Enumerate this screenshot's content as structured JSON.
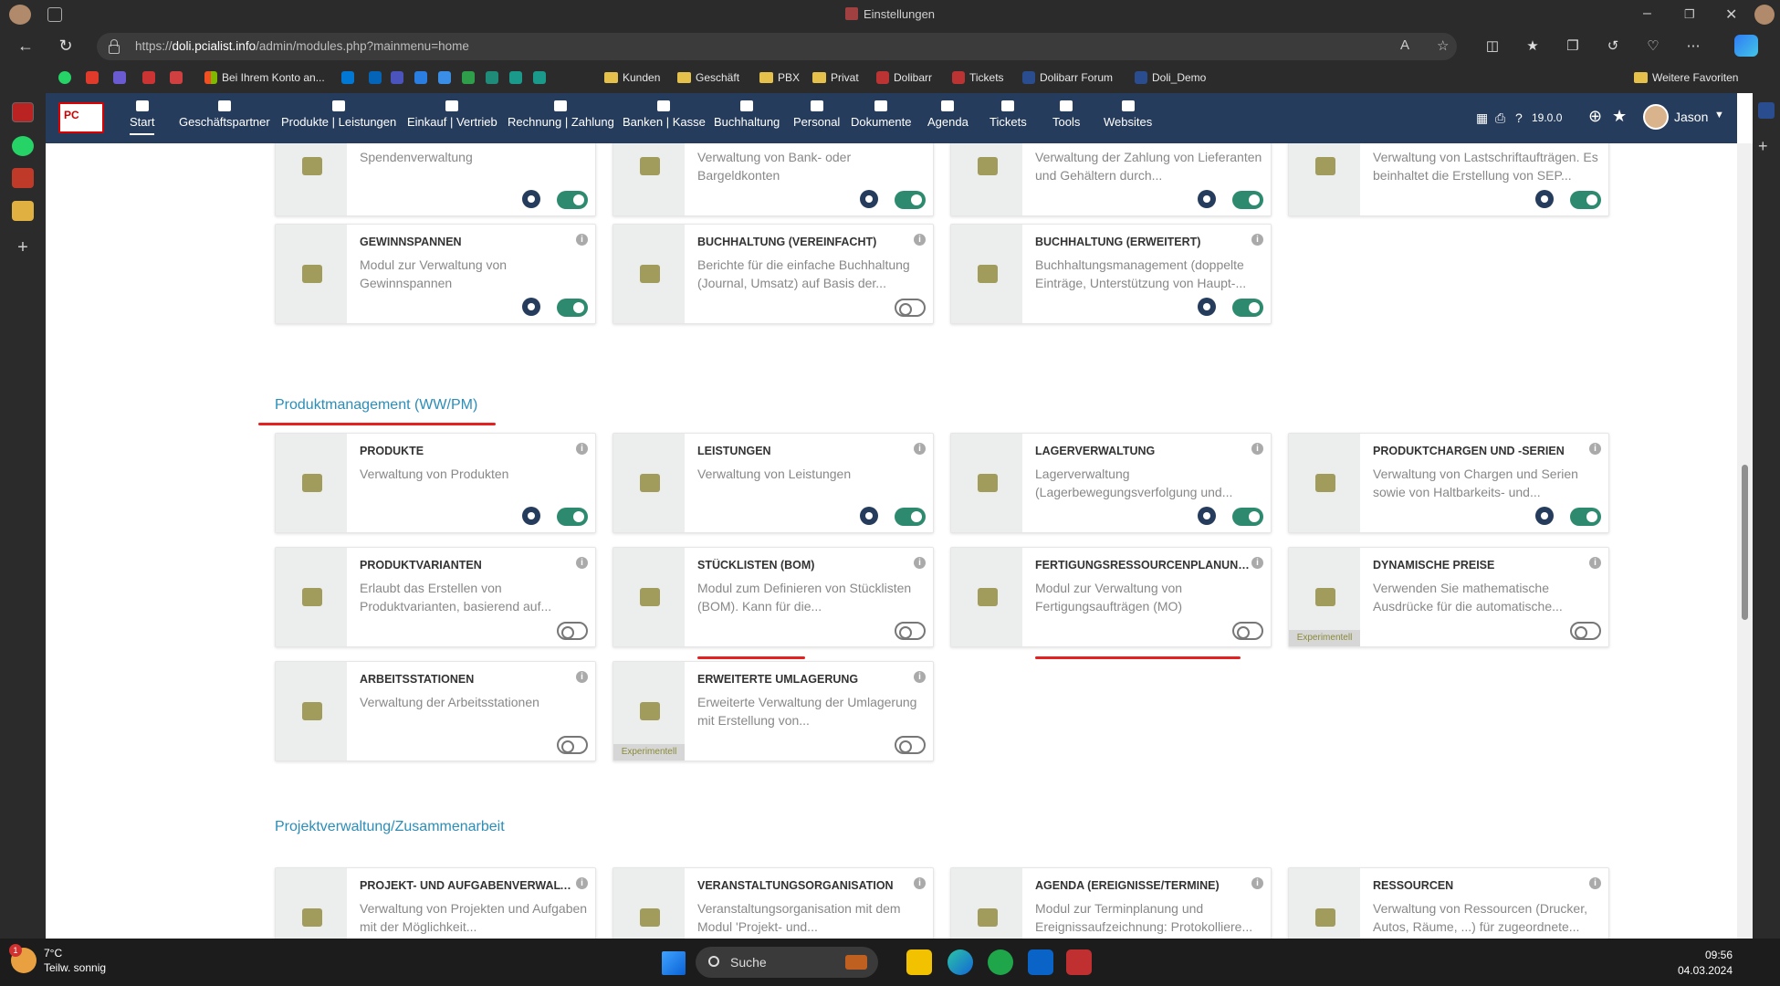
{
  "window": {
    "title": "Einstellungen"
  },
  "address": {
    "url_prefix": "https://",
    "url_host": "doli.pcialist.info",
    "url_path": "/admin/modules.php?mainmenu=home"
  },
  "bookmarks": [
    "Bei Ihrem Konto an...",
    "Kunden",
    "Geschäft",
    "PBX",
    "Privat",
    "Dolibarr",
    "Tickets",
    "Dolibarr Forum",
    "Doli_Demo"
  ],
  "bookmarks_more": "Weitere Favoriten",
  "app": {
    "logo_text": "PC",
    "version": "19.0.0",
    "user": "Jason"
  },
  "nav": [
    "Start",
    "Geschäftspartner",
    "Produkte | Leistungen",
    "Einkauf | Vertrieb",
    "Rechnung | Zahlung",
    "Banken | Kasse",
    "Buchhaltung",
    "Personal",
    "Dokumente",
    "Agenda",
    "Tickets",
    "Tools",
    "Websites"
  ],
  "top_cards": [
    {
      "title": "",
      "desc": "Spendenverwaltung",
      "on": true,
      "gear": true
    },
    {
      "title": "",
      "desc": "Verwaltung von Bank- oder Bargeldkonten",
      "on": true,
      "gear": true
    },
    {
      "title": "",
      "desc": "Verwaltung der Zahlung von Lieferanten und Gehältern durch...",
      "on": true,
      "gear": true
    },
    {
      "title": "",
      "desc": "Verwaltung von Lastschriftaufträgen. Es beinhaltet die Erstellung von SEP...",
      "on": true,
      "gear": true
    },
    {
      "title": "GEWINNSPANNEN",
      "desc": "Modul zur Verwaltung von Gewinnspannen",
      "on": true,
      "gear": true
    },
    {
      "title": "BUCHHALTUNG (VEREINFACHT)",
      "desc": "Berichte für die einfache Buchhaltung (Journal, Umsatz) auf Basis der...",
      "on": false,
      "gear": false
    },
    {
      "title": "BUCHHALTUNG (ERWEITERT)",
      "desc": "Buchhaltungsmanagement (doppelte Einträge, Unterstützung von Haupt-...",
      "on": true,
      "gear": true
    }
  ],
  "sections": {
    "prod": "Produktmanagement (WW/PM)",
    "proj": "Projektverwaltung/Zusammenarbeit"
  },
  "prod_cards": [
    {
      "title": "PRODUKTE",
      "desc": "Verwaltung von Produkten",
      "on": true,
      "gear": true
    },
    {
      "title": "LEISTUNGEN",
      "desc": "Verwaltung von Leistungen",
      "on": true,
      "gear": true
    },
    {
      "title": "LAGERVERWALTUNG",
      "desc": "Lagerverwaltung (Lagerbewegungsverfolgung und...",
      "on": true,
      "gear": true
    },
    {
      "title": "PRODUKTCHARGEN UND -SERIEN",
      "desc": "Verwaltung von Chargen und Serien sowie von Haltbarkeits- und...",
      "on": true,
      "gear": true
    },
    {
      "title": "PRODUKTVARIANTEN",
      "desc": "Erlaubt das Erstellen von Produktvarianten, basierend auf...",
      "on": false,
      "gear": false
    },
    {
      "title": "STÜCKLISTEN (BOM)",
      "desc": "Modul zum Definieren von Stücklisten (BOM). Kann für die...",
      "on": false,
      "gear": false
    },
    {
      "title": "FERTIGUNGSRESSOURCENPLANUNG...",
      "desc": "Modul zur Verwaltung von Fertigungsaufträgen (MO)",
      "on": false,
      "gear": false
    },
    {
      "title": "DYNAMISCHE PREISE",
      "desc": "Verwenden Sie mathematische Ausdrücke für die automatische...",
      "on": false,
      "gear": false,
      "badge": "Experimentell"
    },
    {
      "title": "ARBEITSSTATIONEN",
      "desc": "Verwaltung der Arbeitsstationen",
      "on": false,
      "gear": false
    },
    {
      "title": "ERWEITERTE UMLAGERUNG",
      "desc": "Erweiterte Verwaltung der Umlagerung mit Erstellung von...",
      "on": false,
      "gear": false,
      "badge": "Experimentell"
    }
  ],
  "proj_cards": [
    {
      "title": "PROJEKT- UND AUFGABENVERWALT...",
      "desc": "Verwaltung von Projekten und Aufgaben mit der Möglichkeit..."
    },
    {
      "title": "VERANSTALTUNGSORGANISATION",
      "desc": "Veranstaltungsorganisation mit dem Modul 'Projekt- und..."
    },
    {
      "title": "AGENDA (EREIGNISSE/TERMINE)",
      "desc": "Modul zur Terminplanung und Ereignissaufzeichnung: Protokolliere..."
    },
    {
      "title": "RESSOURCEN",
      "desc": "Verwaltung von Ressourcen (Drucker, Autos, Räume, ...) für zugeordnete..."
    }
  ],
  "taskbar": {
    "temp": "7°C",
    "weather": "Teilw. sonnig",
    "badge": "1",
    "search": "Suche",
    "time": "09:56",
    "date": "04.03.2024"
  }
}
